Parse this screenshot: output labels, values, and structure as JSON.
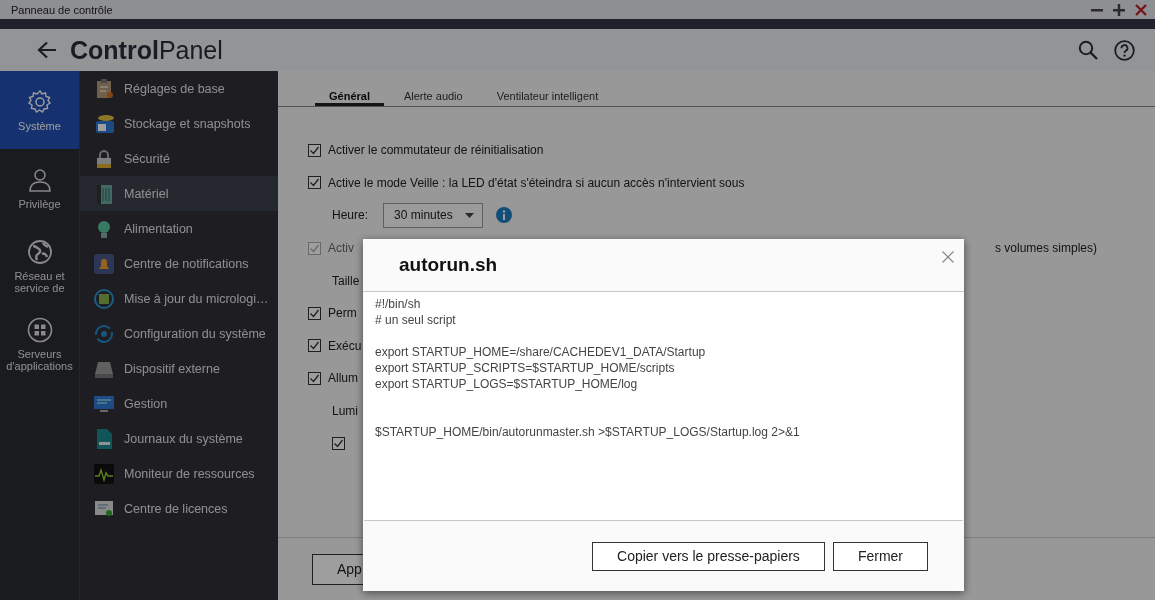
{
  "window": {
    "title": "Panneau de contrôle"
  },
  "header": {
    "title_bold": "Control",
    "title_light": "Panel"
  },
  "nav": [
    {
      "label": "Système",
      "kind": "gear",
      "selected": true
    },
    {
      "label": "Privilège",
      "kind": "person",
      "selected": false
    },
    {
      "label": "Réseau et service de",
      "kind": "globe",
      "selected": false
    },
    {
      "label": "Serveurs d'applications",
      "kind": "apps",
      "selected": false
    }
  ],
  "menu": [
    {
      "label": "Réglages de base",
      "kind": "clipboard",
      "selected": false
    },
    {
      "label": "Stockage et snapshots",
      "kind": "storage",
      "selected": false
    },
    {
      "label": "Sécurité",
      "kind": "lock",
      "selected": false
    },
    {
      "label": "Matériel",
      "kind": "hardware",
      "selected": true
    },
    {
      "label": "Alimentation",
      "kind": "bulb",
      "selected": false
    },
    {
      "label": "Centre de notifications",
      "kind": "bell",
      "selected": false
    },
    {
      "label": "Mise à jour du micrologi…",
      "kind": "chip",
      "selected": false
    },
    {
      "label": "Configuration du système",
      "kind": "cycle",
      "selected": false
    },
    {
      "label": "Dispositif externe",
      "kind": "drive",
      "selected": false
    },
    {
      "label": "Gestion",
      "kind": "monitor",
      "selected": false
    },
    {
      "label": "Journaux du système",
      "kind": "log",
      "selected": false
    },
    {
      "label": "Moniteur de ressources",
      "kind": "pulse",
      "selected": false
    },
    {
      "label": "Centre de licences",
      "kind": "certificate",
      "selected": false
    }
  ],
  "tabs": [
    {
      "label": "Général",
      "selected": true
    },
    {
      "label": "Alerte audio",
      "selected": false
    },
    {
      "label": "Ventilateur intelligent",
      "selected": false
    }
  ],
  "settings": [
    {
      "kind": "checkbox",
      "label": "Activer le commutateur de réinitialisation",
      "checked": true,
      "disabled": false
    },
    {
      "kind": "checkbox",
      "label": "Active le mode Veille : la LED d'état s'éteindra si aucun accès n'intervient sous",
      "checked": true,
      "disabled": false
    },
    {
      "kind": "select",
      "label": "Heure:",
      "value": "30 minutes"
    },
    {
      "kind": "checkbox",
      "label": "Activ",
      "tail": "s volumes simples)",
      "checked": true,
      "disabled": true
    },
    {
      "kind": "text",
      "label": "Taille"
    },
    {
      "kind": "checkbox",
      "label": "Perm",
      "checked": true,
      "disabled": false
    },
    {
      "kind": "checkbox",
      "label": "Exécu",
      "checked": true,
      "disabled": false
    },
    {
      "kind": "checkbox",
      "label": "Allum",
      "checked": true,
      "disabled": false
    },
    {
      "kind": "text",
      "label": "Lumi"
    },
    {
      "kind": "subcheckbox",
      "checked": true,
      "disabled": false
    }
  ],
  "apply_button": "App",
  "dialog": {
    "title": "autorun.sh",
    "content": "#!/bin/sh\n# un seul script\n\nexport STARTUP_HOME=/share/CACHEDEV1_DATA/Startup\nexport STARTUP_SCRIPTS=$STARTUP_HOME/scripts\nexport STARTUP_LOGS=$STARTUP_HOME/log\n\n\n$STARTUP_HOME/bin/autorunmaster.sh >$STARTUP_LOGS/Startup.log 2>&1",
    "buttons": [
      "Copier vers le presse-papiers",
      "Fermer"
    ]
  }
}
